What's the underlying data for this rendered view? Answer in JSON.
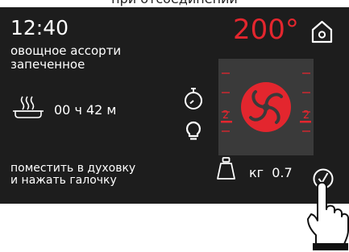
{
  "header": {
    "caption": "при отсоединении"
  },
  "display": {
    "time": "12:40",
    "temperature": "200°",
    "recipe_line1": "овощное ассорти",
    "recipe_line2": "запеченное",
    "duration": "00 ч 42 м",
    "instruction_line1": "поместить в духовку",
    "instruction_line2": "и нажать галочку",
    "weight_unit": "кг",
    "weight_value": "0.7",
    "fan_level_left": "2",
    "fan_level_right": "2"
  },
  "icons": {
    "home": "home-icon",
    "dish": "steaming-dish-icon",
    "timer": "stopwatch-icon",
    "light": "light-bulb-icon",
    "fan": "convection-fan-icon",
    "weight": "weight-icon",
    "confirm": "checkmark-icon",
    "hand": "pointing-hand-icon"
  },
  "colors": {
    "screen_bg": "#1d1d1d",
    "panel_bg": "#3a3a3a",
    "accent_red": "#e3262e",
    "text": "#ffffff"
  }
}
